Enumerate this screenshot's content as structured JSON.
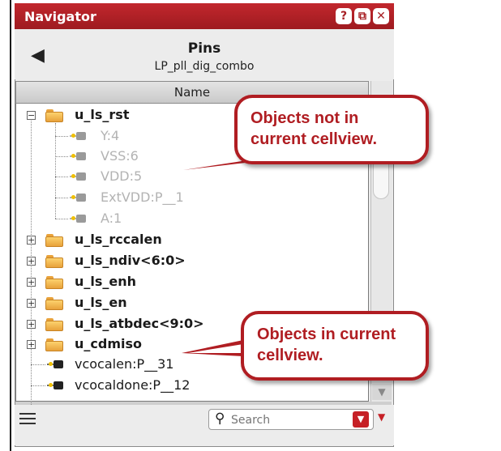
{
  "window": {
    "title": "Navigator",
    "buttons": {
      "help": "?",
      "float": "⧉",
      "close": "✕"
    }
  },
  "header": {
    "back_icon": "◀",
    "title": "Pins",
    "subtitle": "LP_pll_dig_combo"
  },
  "list": {
    "column_header": "Name",
    "rows": [
      {
        "label": "u_ls_rst",
        "type": "folder",
        "state": "expanded"
      },
      {
        "label": "Y:4",
        "type": "pin",
        "state": "not-in-cellview"
      },
      {
        "label": "VSS:6",
        "type": "pin",
        "state": "not-in-cellview"
      },
      {
        "label": "VDD:5",
        "type": "pin",
        "state": "not-in-cellview"
      },
      {
        "label": "ExtVDD:P__1",
        "type": "pin",
        "state": "not-in-cellview"
      },
      {
        "label": "A:1",
        "type": "pin",
        "state": "not-in-cellview"
      },
      {
        "label": "u_ls_rccalen",
        "type": "folder",
        "state": "collapsed"
      },
      {
        "label": "u_ls_ndiv<6:0>",
        "type": "folder",
        "state": "collapsed"
      },
      {
        "label": "u_ls_enh",
        "type": "folder",
        "state": "collapsed"
      },
      {
        "label": "u_ls_en",
        "type": "folder",
        "state": "collapsed"
      },
      {
        "label": "u_ls_atbdec<9:0>",
        "type": "folder",
        "state": "collapsed"
      },
      {
        "label": "u_cdmiso",
        "type": "folder",
        "state": "collapsed"
      },
      {
        "label": "vcocalen:P__31",
        "type": "pin",
        "state": "in-cellview"
      },
      {
        "label": "vcocaldone:P__12",
        "type": "pin",
        "state": "in-cellview"
      }
    ]
  },
  "footer": {
    "search_placeholder": "Search"
  },
  "callouts": {
    "top": "Objects not in current cellview.",
    "bottom": "Objects in current cellview."
  },
  "colors": {
    "accent": "#b01d22",
    "titlebar": "#b3232a",
    "dim_text": "#b3b3b3",
    "folder": "#f2b84b"
  }
}
